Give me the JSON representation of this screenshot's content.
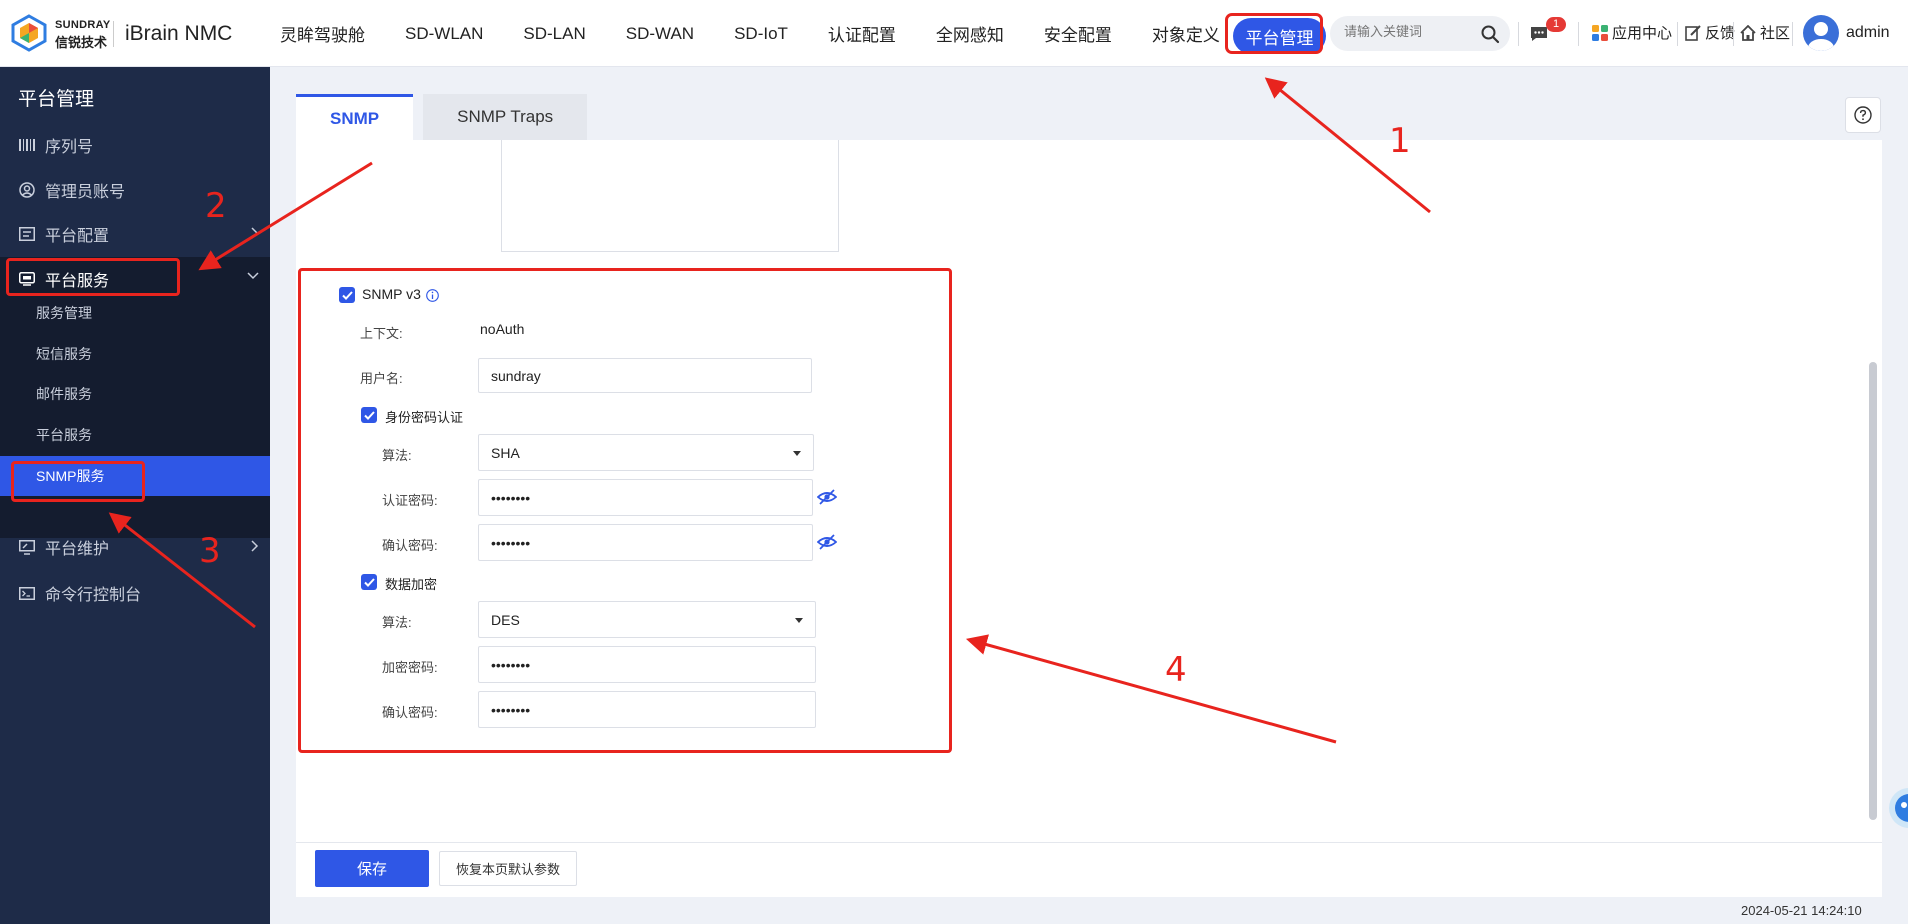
{
  "brand": {
    "company_en": "SUNDRAY",
    "company_cn": "信锐技术",
    "product": "iBrain NMC"
  },
  "nav": {
    "items": [
      "灵眸驾驶舱",
      "SD-WLAN",
      "SD-LAN",
      "SD-WAN",
      "SD-IoT",
      "认证配置",
      "全网感知",
      "安全配置",
      "对象定义"
    ],
    "active": "平台管理"
  },
  "search": {
    "placeholder": "请输入关键词"
  },
  "notifications": {
    "count": "1"
  },
  "toolbar": {
    "app_center": "应用中心",
    "feedback": "反馈",
    "community": "社区"
  },
  "user": {
    "name": "admin"
  },
  "sidebar": {
    "title": "平台管理",
    "items": [
      {
        "label": "序列号",
        "icon": "barcode-icon"
      },
      {
        "label": "管理员账号",
        "icon": "user-circle-icon"
      },
      {
        "label": "平台配置",
        "icon": "list-icon"
      },
      {
        "label": "平台服务",
        "icon": "service-icon"
      },
      {
        "label": "平台维护",
        "icon": "monitor-icon"
      },
      {
        "label": "命令行控制台",
        "icon": "terminal-icon"
      }
    ],
    "submenu": [
      "服务管理",
      "短信服务",
      "邮件服务",
      "平台服务",
      "SNMP服务"
    ]
  },
  "tabs": [
    "SNMP",
    "SNMP Traps"
  ],
  "snmp_v3": {
    "label": "SNMP v3",
    "enabled": true,
    "context_label": "上下文:",
    "context_value": "noAuth",
    "username_label": "用户名:",
    "username_value": "sundray",
    "auth": {
      "label": "身份密码认证",
      "enabled": true,
      "algo_label": "算法:",
      "algo_value": "SHA",
      "password_label": "认证密码:",
      "password_value": "••••••••",
      "confirm_label": "确认密码:",
      "confirm_value": "••••••••"
    },
    "encrypt": {
      "label": "数据加密",
      "enabled": true,
      "algo_label": "算法:",
      "algo_value": "DES",
      "password_label": "加密密码:",
      "password_value": "••••••••",
      "confirm_label": "确认密码:",
      "confirm_value": "••••••••"
    }
  },
  "footer": {
    "save": "保存",
    "restore": "恢复本页默认参数"
  },
  "timestamp": "2024-05-21 14:24:10",
  "annotations": [
    "1",
    "2",
    "3",
    "4"
  ],
  "colors": {
    "accent": "#2f57e6",
    "sidebar": "#1e2b48",
    "annotation": "#e8241e"
  }
}
